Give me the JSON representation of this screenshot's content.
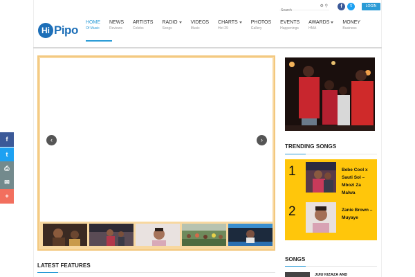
{
  "header": {
    "logo_badge": "Hi",
    "logo_text": "Pipo",
    "search_placeholder": "Search",
    "login_label": "LOGIN",
    "nav": [
      {
        "label": "HOME",
        "sub": "Of Music"
      },
      {
        "label": "NEWS",
        "sub": "Reviews"
      },
      {
        "label": "ARTISTS",
        "sub": "Celebs"
      },
      {
        "label": "RADIO",
        "sub": "Songs"
      },
      {
        "label": "VIDEOS",
        "sub": "Music"
      },
      {
        "label": "CHARTS",
        "sub": "Hot 29"
      },
      {
        "label": "PHOTOS",
        "sub": "Gallery"
      },
      {
        "label": "EVENTS",
        "sub": "Happenings"
      },
      {
        "label": "AWARDS",
        "sub": "HMA"
      },
      {
        "label": "MONEY",
        "sub": "Business"
      }
    ]
  },
  "sections": {
    "trending_title": "TRENDING SONGS",
    "latest_title": "LATEST FEATURES",
    "songs_title": "SONGS"
  },
  "trending": [
    {
      "rank": "1",
      "title": "Bebe Cool x Sauti Sol – Mbozi Za Malwa"
    },
    {
      "rank": "2",
      "title": "Zanie Brown – Muyaye"
    }
  ],
  "songs_preview": "JUIU KIZAZA AND",
  "share": {
    "facebook": "f",
    "twitter": "t",
    "print": "⎙",
    "email": "✉",
    "more": "+"
  },
  "colors": {
    "accent": "#2a9bd6",
    "trending_bg": "#ffc60b",
    "slider_border": "#f3c87f"
  }
}
